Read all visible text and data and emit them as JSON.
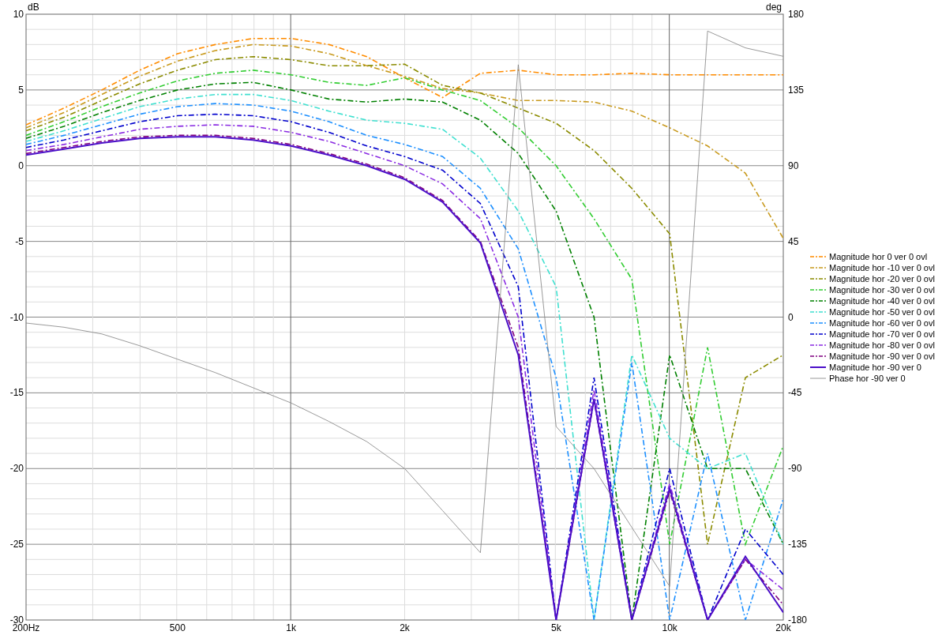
{
  "chart_data": {
    "type": "line",
    "ylabel": "dB",
    "y2label": "deg",
    "grid": true,
    "categories": [
      "200Hz",
      null,
      null,
      null,
      "500",
      null,
      null,
      "1k",
      null,
      null,
      "2k",
      null,
      null,
      null,
      "5k",
      null,
      null,
      "10k",
      null,
      null,
      "20k"
    ],
    "ylim": [
      -30,
      10
    ],
    "yticks": [
      10,
      5,
      0,
      -5,
      -10,
      -15,
      -20,
      -25,
      -30
    ],
    "y2lim": [
      -180,
      180
    ],
    "y2ticks": [
      180,
      135,
      90,
      45,
      0,
      -45,
      -90,
      -135,
      -180
    ],
    "series": [
      {
        "name": "Magnitude hor 0 ver 0 ovl",
        "line_style": "dashdot",
        "color": "#ff8c00",
        "values": [
          2.7,
          3.8,
          5.0,
          6.3,
          7.4,
          8.0,
          8.4,
          8.4,
          8.0,
          7.2,
          5.8,
          4.5,
          6.1,
          6.3,
          6.0,
          6.0,
          6.1,
          6.0,
          6.0,
          6.0,
          6.0
        ]
      },
      {
        "name": "Magnitude hor -10 ver 0 ovl",
        "line_style": "dashdot",
        "color": "#c89a1e",
        "values": [
          2.5,
          3.5,
          4.7,
          5.9,
          6.9,
          7.6,
          8.0,
          7.9,
          7.4,
          6.6,
          5.9,
          5.1,
          4.8,
          4.3,
          4.3,
          4.2,
          3.6,
          2.5,
          1.3,
          -0.5,
          -4.8
        ]
      },
      {
        "name": "Magnitude hor -20 ver 0 ovl",
        "line_style": "dashdot",
        "color": "#8b8b00",
        "values": [
          2.3,
          3.2,
          4.3,
          5.4,
          6.3,
          7.0,
          7.2,
          7.0,
          6.6,
          6.6,
          6.7,
          5.3,
          4.8,
          3.8,
          2.8,
          1.0,
          -1.5,
          -4.5,
          -25,
          -14,
          -12.5
        ]
      },
      {
        "name": "Magnitude hor -30 ver 0 ovl",
        "line_style": "dashdot",
        "color": "#32cd32",
        "values": [
          2.0,
          2.9,
          3.9,
          4.8,
          5.6,
          6.1,
          6.3,
          6.0,
          5.5,
          5.3,
          5.8,
          5.0,
          4.3,
          2.5,
          0.0,
          -3.5,
          -7.5,
          -25,
          -12,
          -25,
          -18.5
        ]
      },
      {
        "name": "Magnitude hor -40 ver 0 ovl",
        "line_style": "dashdot",
        "color": "#008000",
        "values": [
          1.8,
          2.6,
          3.5,
          4.3,
          5.0,
          5.4,
          5.5,
          5.0,
          4.4,
          4.2,
          4.4,
          4.2,
          3.0,
          0.8,
          -3.0,
          -10,
          -30,
          -12.5,
          -20,
          -20,
          -25
        ]
      },
      {
        "name": "Magnitude hor -50 ver 0 ovl",
        "line_style": "dashdot",
        "color": "#40e0d0",
        "values": [
          1.6,
          2.3,
          3.1,
          3.9,
          4.4,
          4.7,
          4.7,
          4.3,
          3.6,
          3.0,
          2.8,
          2.4,
          0.5,
          -3.0,
          -8,
          -30,
          -12.5,
          -18,
          -20,
          -19,
          -25
        ]
      },
      {
        "name": "Magnitude hor -60 ver 0 ovl",
        "line_style": "dashdot",
        "color": "#1e90ff",
        "values": [
          1.4,
          2.0,
          2.7,
          3.4,
          3.9,
          4.1,
          4.0,
          3.6,
          2.9,
          2.0,
          1.4,
          0.6,
          -1.5,
          -5.5,
          -14,
          -30,
          -13,
          -30,
          -19,
          -30,
          -22
        ]
      },
      {
        "name": "Magnitude hor -70 ver 0 ovl",
        "line_style": "dashdot",
        "color": "#0000cd",
        "values": [
          1.2,
          1.7,
          2.3,
          2.9,
          3.3,
          3.4,
          3.3,
          2.9,
          2.2,
          1.3,
          0.6,
          -0.3,
          -2.5,
          -8,
          -30,
          -14,
          -30,
          -20,
          -30,
          -24,
          -27
        ]
      },
      {
        "name": "Magnitude hor -80 ver 0 ovl",
        "line_style": "dashdot",
        "color": "#8a2be2",
        "values": [
          1.0,
          1.4,
          1.9,
          2.4,
          2.6,
          2.7,
          2.6,
          2.2,
          1.6,
          0.8,
          0.0,
          -1.2,
          -3.5,
          -10,
          -30,
          -14.8,
          -30,
          -21,
          -30,
          -26,
          -28
        ]
      },
      {
        "name": "Magnitude hor -90 ver 0 ovl",
        "line_style": "dashdot",
        "color": "#800080",
        "values": [
          0.8,
          1.2,
          1.6,
          1.9,
          2.0,
          2.0,
          1.8,
          1.4,
          0.8,
          0.1,
          -0.8,
          -2.3,
          -5.0,
          -12,
          -30,
          -15.5,
          -30,
          -21.5,
          -30,
          -26,
          -29
        ]
      },
      {
        "name": "Magnitude hor -90 ver 0",
        "line_style": "solid",
        "color": "#4b0fc8",
        "values": [
          0.7,
          1.1,
          1.5,
          1.8,
          1.9,
          1.9,
          1.7,
          1.3,
          0.7,
          0.0,
          -0.9,
          -2.4,
          -5.1,
          -12.5,
          -30,
          -15.4,
          -30,
          -21.3,
          -30,
          -25.8,
          -29.5
        ]
      },
      {
        "name": "Phase hor -90 ver 0",
        "line_style": "solid",
        "axis": "y2",
        "color": "#808080",
        "values": [
          -3.5,
          -6,
          -10,
          -17,
          -25,
          -33,
          -42,
          -51,
          -62,
          -74,
          -90,
          -115,
          -140,
          150,
          -65,
          -90,
          -125,
          -160,
          170,
          160,
          155
        ]
      }
    ]
  }
}
